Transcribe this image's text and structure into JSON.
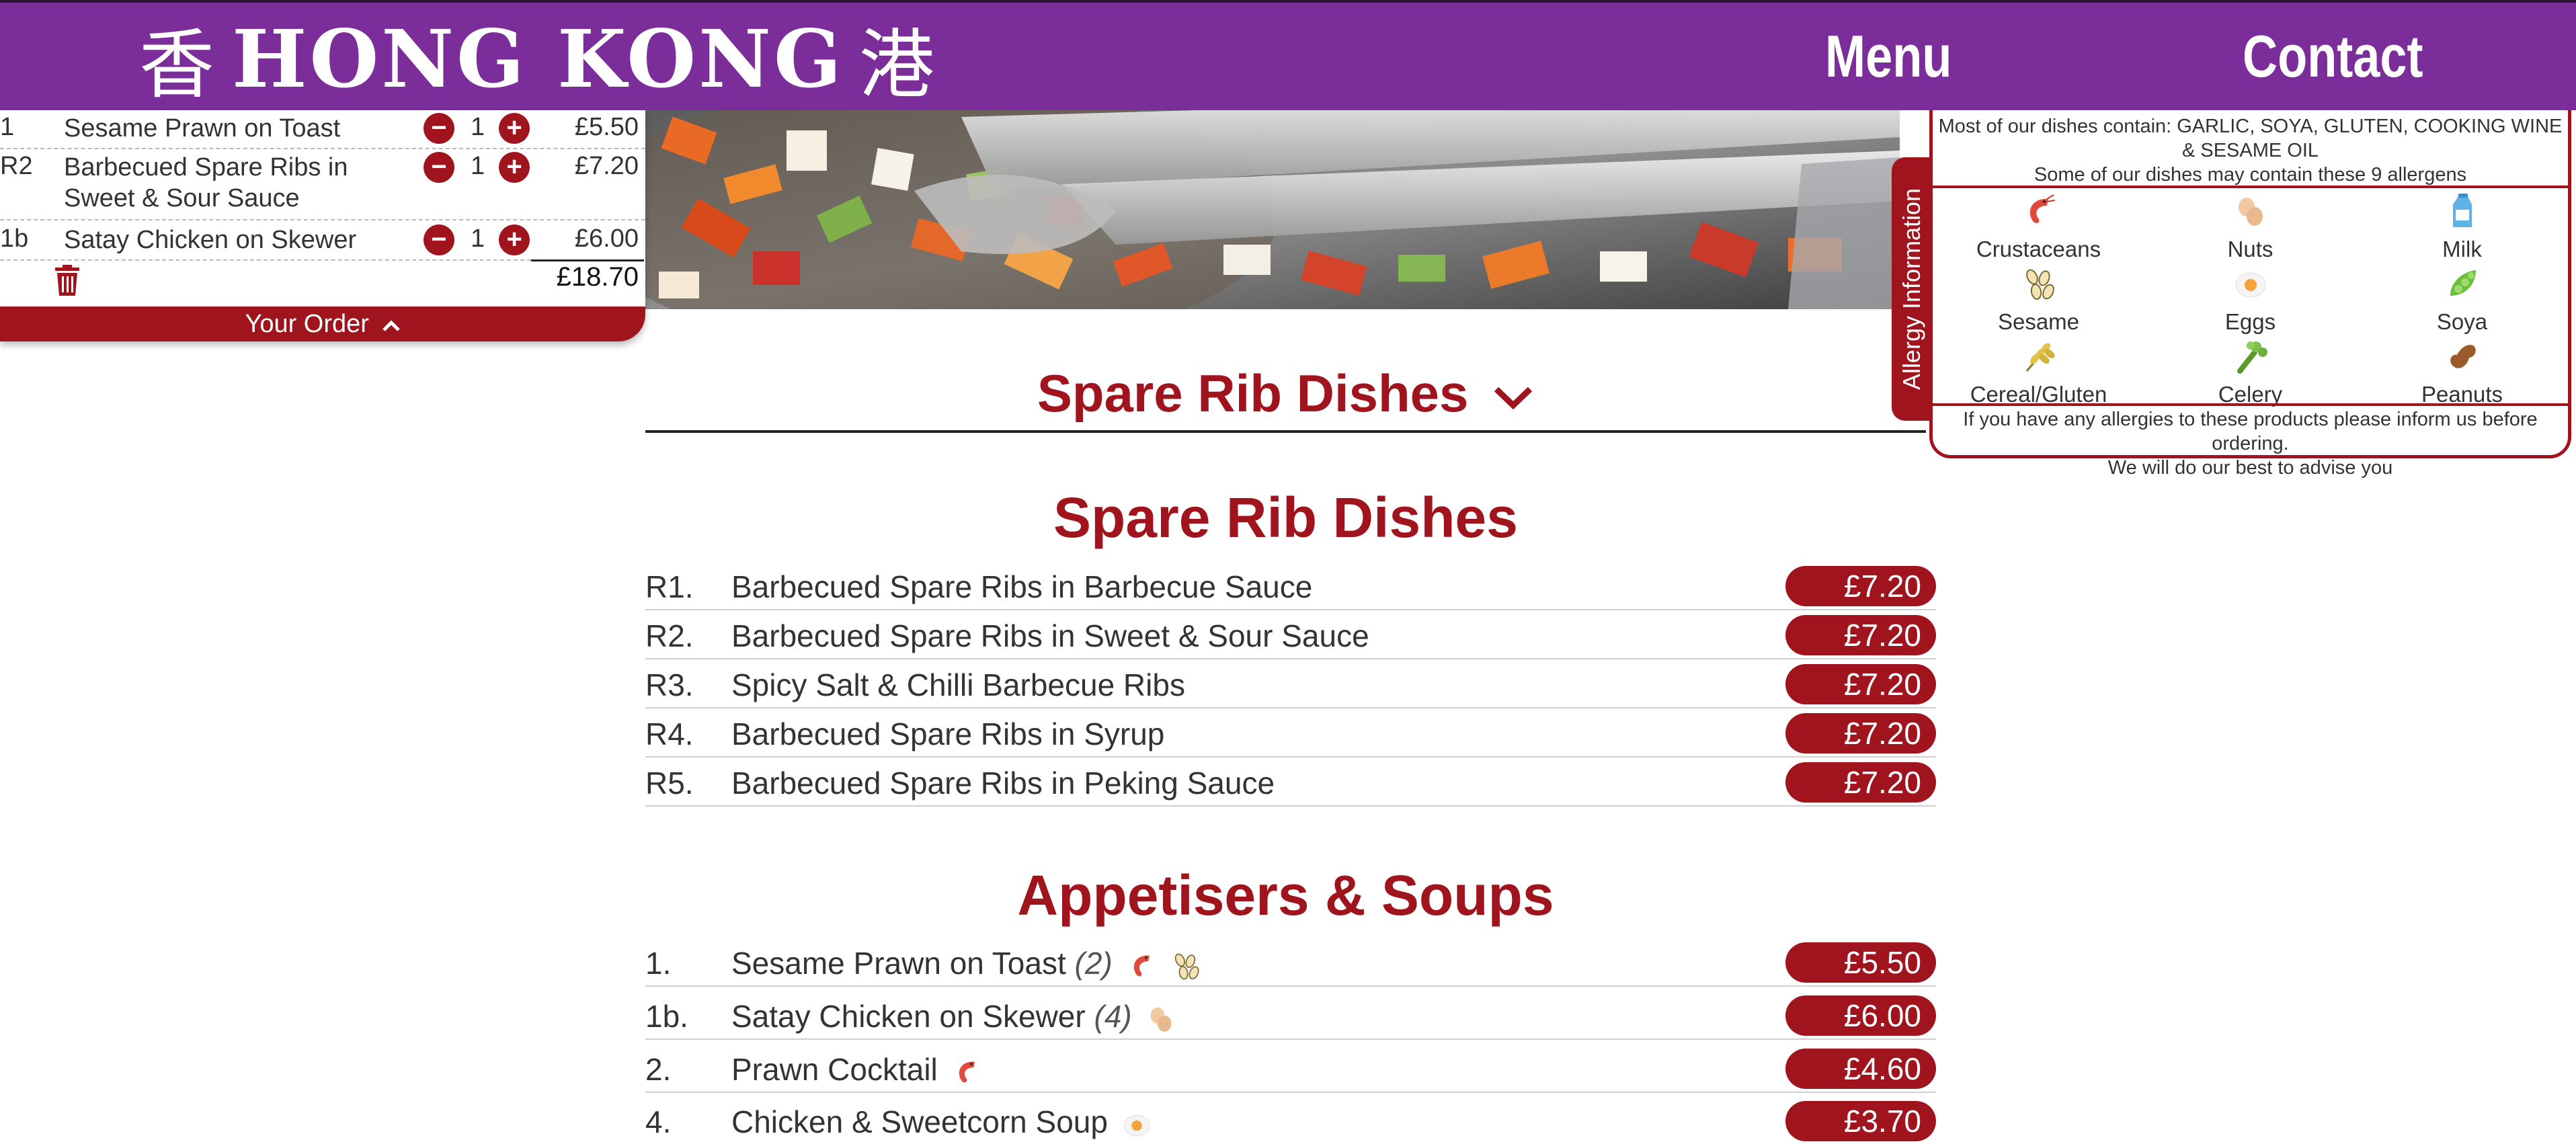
{
  "header": {
    "logo_char_left": "香",
    "logo_text": "HONG KONG",
    "logo_char_right": "港",
    "nav_menu": "Menu",
    "nav_contact": "Contact"
  },
  "order": {
    "items": [
      {
        "code": "1",
        "name": "Sesame Prawn on Toast",
        "qty": "1",
        "price": "£5.50"
      },
      {
        "code": "R2",
        "name": "Barbecued Spare Ribs in Sweet & Sour Sauce",
        "qty": "1",
        "price": "£7.20"
      },
      {
        "code": "1b",
        "name": "Satay Chicken on Skewer",
        "qty": "1",
        "price": "£6.00"
      }
    ],
    "total": "£18.70",
    "toggle_label": "Your Order"
  },
  "allergy": {
    "tab_label": "Allergy Information",
    "top_line1": "Most of our dishes contain: GARLIC, SOYA, GLUTEN, COOKING WINE & SESAME OIL",
    "top_line2": "Some of our dishes may contain these 9 allergens",
    "items": [
      {
        "label": "Crustaceans",
        "icon": "shrimp-icon"
      },
      {
        "label": "Nuts",
        "icon": "nut-icon"
      },
      {
        "label": "Milk",
        "icon": "milk-carton-icon"
      },
      {
        "label": "Sesame",
        "icon": "sesame-seeds-icon"
      },
      {
        "label": "Eggs",
        "icon": "egg-icon"
      },
      {
        "label": "Soya",
        "icon": "soybean-icon"
      },
      {
        "label": "Cereal/Gluten",
        "icon": "wheat-icon"
      },
      {
        "label": "Celery",
        "icon": "celery-icon"
      },
      {
        "label": "Peanuts",
        "icon": "peanut-icon"
      }
    ],
    "bottom_line1": "If you have any allergies to these products please inform us before ordering.",
    "bottom_line2": "We will do our best to advise you"
  },
  "menu": {
    "dropdown_label": "Spare Rib Dishes",
    "sections": [
      {
        "title": "Spare Rib Dishes",
        "items": [
          {
            "num": "R1.",
            "name": "Barbecued Spare Ribs in Barbecue Sauce",
            "price": "£7.20"
          },
          {
            "num": "R2.",
            "name": "Barbecued Spare Ribs in Sweet & Sour Sauce",
            "price": "£7.20"
          },
          {
            "num": "R3.",
            "name": "Spicy Salt & Chilli Barbecue Ribs",
            "price": "£7.20"
          },
          {
            "num": "R4.",
            "name": "Barbecued Spare Ribs in Syrup",
            "price": "£7.20"
          },
          {
            "num": "R5.",
            "name": "Barbecued Spare Ribs in Peking Sauce",
            "price": "£7.20"
          }
        ]
      },
      {
        "title": "Appetisers & Soups",
        "items": [
          {
            "num": "1.",
            "name": "Sesame Prawn on Toast",
            "portion": "(2)",
            "price": "£5.50"
          },
          {
            "num": "1b.",
            "name": "Satay Chicken on Skewer",
            "portion": "(4)",
            "price": "£6.00"
          },
          {
            "num": "2.",
            "name": "Prawn Cocktail",
            "price": "£4.60"
          },
          {
            "num": "4.",
            "name": "Chicken & Sweetcorn Soup",
            "price": "£3.70"
          }
        ]
      }
    ]
  },
  "colors": {
    "brand_purple": "#7b2d9a",
    "accent_red": "#a0141e"
  }
}
